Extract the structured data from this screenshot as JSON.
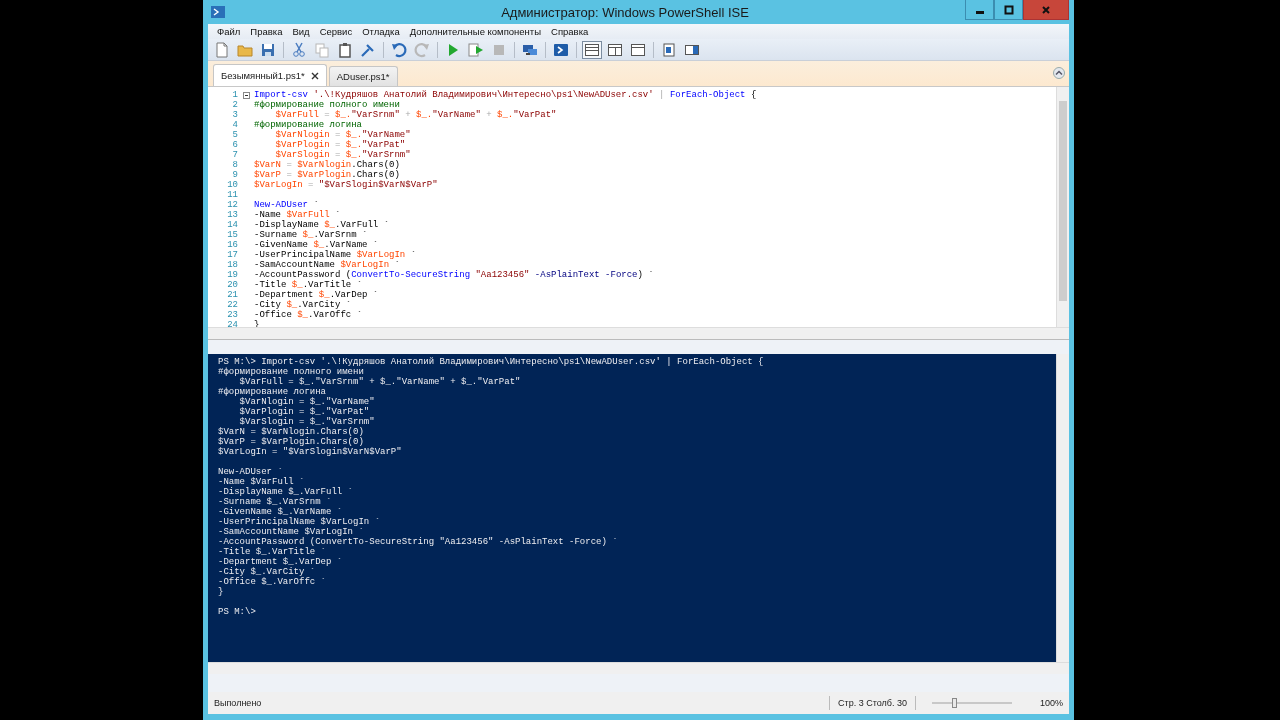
{
  "window": {
    "title": "Администратор: Windows PowerShell ISE"
  },
  "menu": [
    "Файл",
    "Правка",
    "Вид",
    "Сервис",
    "Отладка",
    "Дополнительные компоненты",
    "Справка"
  ],
  "toolbar": [
    {
      "kind": "new",
      "disabled": false
    },
    {
      "kind": "open",
      "disabled": false
    },
    {
      "kind": "save",
      "disabled": false
    },
    {
      "kind": "sep"
    },
    {
      "kind": "cut",
      "disabled": false
    },
    {
      "kind": "copy",
      "disabled": true
    },
    {
      "kind": "paste",
      "disabled": false
    },
    {
      "kind": "clear",
      "disabled": false
    },
    {
      "kind": "sep"
    },
    {
      "kind": "undo",
      "disabled": false
    },
    {
      "kind": "redo",
      "disabled": true
    },
    {
      "kind": "sep"
    },
    {
      "kind": "run",
      "disabled": false
    },
    {
      "kind": "runsel",
      "disabled": false
    },
    {
      "kind": "stop",
      "disabled": true
    },
    {
      "kind": "sep"
    },
    {
      "kind": "remote",
      "disabled": false
    },
    {
      "kind": "sep"
    },
    {
      "kind": "console",
      "disabled": false
    },
    {
      "kind": "sep"
    },
    {
      "kind": "layout-top",
      "selected": true
    },
    {
      "kind": "layout-right",
      "selected": false
    },
    {
      "kind": "layout-max",
      "selected": false
    },
    {
      "kind": "sep"
    },
    {
      "kind": "show-script",
      "disabled": false
    },
    {
      "kind": "show-addon",
      "disabled": false
    }
  ],
  "tabs": [
    {
      "label": "Безымянный1.ps1*",
      "selected": true
    },
    {
      "label": "ADuser.ps1*",
      "selected": false
    }
  ],
  "editor": {
    "lines": [
      {
        "number": "1",
        "fold": true,
        "tokens": [
          {
            "kind": "cmd",
            "text": "Import-csv"
          },
          {
            "kind": "str",
            "text": " '.\\!Кудряшов Анатолий Владимирович\\Интересно\\ps1\\NewADUser.csv'"
          },
          {
            "kind": "op",
            "text": " |"
          },
          {
            "kind": "cmd",
            "text": " ForEach-Object"
          },
          {
            "kind": "plain",
            "text": " {"
          }
        ]
      },
      {
        "number": "2",
        "tokens": [
          {
            "kind": "comment",
            "text": "#формирование полного имени"
          }
        ]
      },
      {
        "number": "3",
        "tokens": [
          {
            "kind": "var",
            "text": "    $VarFull"
          },
          {
            "kind": "op",
            "text": " = "
          },
          {
            "kind": "var",
            "text": "$_."
          },
          {
            "kind": "str",
            "text": "\"VarSrnm\""
          },
          {
            "kind": "op",
            "text": " + "
          },
          {
            "kind": "var",
            "text": "$_."
          },
          {
            "kind": "str",
            "text": "\"VarName\""
          },
          {
            "kind": "op",
            "text": " + "
          },
          {
            "kind": "var",
            "text": "$_."
          },
          {
            "kind": "str",
            "text": "\"VarPat\""
          }
        ]
      },
      {
        "number": "4",
        "tokens": [
          {
            "kind": "comment",
            "text": "#формирование логина"
          }
        ]
      },
      {
        "number": "5",
        "tokens": [
          {
            "kind": "var",
            "text": "    $VarNlogin"
          },
          {
            "kind": "op",
            "text": " = "
          },
          {
            "kind": "var",
            "text": "$_."
          },
          {
            "kind": "str",
            "text": "\"VarName\""
          }
        ]
      },
      {
        "number": "6",
        "tokens": [
          {
            "kind": "var",
            "text": "    $VarPlogin"
          },
          {
            "kind": "op",
            "text": " = "
          },
          {
            "kind": "var",
            "text": "$_."
          },
          {
            "kind": "str",
            "text": "\"VarPat\""
          }
        ]
      },
      {
        "number": "7",
        "tokens": [
          {
            "kind": "var",
            "text": "    $VarSlogin"
          },
          {
            "kind": "op",
            "text": " = "
          },
          {
            "kind": "var",
            "text": "$_."
          },
          {
            "kind": "str",
            "text": "\"VarSrnm\""
          }
        ]
      },
      {
        "number": "8",
        "tokens": [
          {
            "kind": "var",
            "text": "$VarN"
          },
          {
            "kind": "op",
            "text": " = "
          },
          {
            "kind": "var",
            "text": "$VarNlogin"
          },
          {
            "kind": "plain",
            "text": ".Chars(0)"
          }
        ]
      },
      {
        "number": "9",
        "tokens": [
          {
            "kind": "var",
            "text": "$VarP"
          },
          {
            "kind": "op",
            "text": " = "
          },
          {
            "kind": "var",
            "text": "$VarPlogin"
          },
          {
            "kind": "plain",
            "text": ".Chars(0)"
          }
        ]
      },
      {
        "number": "10",
        "tokens": [
          {
            "kind": "var",
            "text": "$VarLogIn"
          },
          {
            "kind": "op",
            "text": " = "
          },
          {
            "kind": "str",
            "text": "\"$VarSlogin$VarN$VarP\""
          }
        ]
      },
      {
        "number": "11"
      },
      {
        "number": "12",
        "tokens": [
          {
            "kind": "cmd",
            "text": "New-ADUser"
          },
          {
            "kind": "plain",
            "text": " `"
          }
        ]
      },
      {
        "number": "13",
        "tokens": [
          {
            "kind": "plain",
            "text": "-Name "
          },
          {
            "kind": "var",
            "text": "$VarFull"
          },
          {
            "kind": "plain",
            "text": " `"
          }
        ]
      },
      {
        "number": "14",
        "tokens": [
          {
            "kind": "plain",
            "text": "-DisplayName "
          },
          {
            "kind": "var",
            "text": "$_"
          },
          {
            "kind": "plain",
            "text": ".VarFull `"
          }
        ]
      },
      {
        "number": "15",
        "tokens": [
          {
            "kind": "plain",
            "text": "-Surname "
          },
          {
            "kind": "var",
            "text": "$_"
          },
          {
            "kind": "plain",
            "text": ".VarSrnm `"
          }
        ]
      },
      {
        "number": "16",
        "tokens": [
          {
            "kind": "plain",
            "text": "-GivenName "
          },
          {
            "kind": "var",
            "text": "$_"
          },
          {
            "kind": "plain",
            "text": ".VarName `"
          }
        ]
      },
      {
        "number": "17",
        "tokens": [
          {
            "kind": "plain",
            "text": "-UserPrincipalName "
          },
          {
            "kind": "var",
            "text": "$VarLogIn"
          },
          {
            "kind": "plain",
            "text": " `"
          }
        ]
      },
      {
        "number": "18",
        "tokens": [
          {
            "kind": "plain",
            "text": "-SamAccountName "
          },
          {
            "kind": "var",
            "text": "$VarLogIn"
          },
          {
            "kind": "plain",
            "text": " `"
          }
        ]
      },
      {
        "number": "19",
        "tokens": [
          {
            "kind": "plain",
            "text": "-AccountPassword ("
          },
          {
            "kind": "cmd",
            "text": "ConvertTo-SecureString"
          },
          {
            "kind": "str",
            "text": " \"Aa123456\""
          },
          {
            "kind": "param",
            "text": " -AsPlainText"
          },
          {
            "kind": "param",
            "text": " -Force"
          },
          {
            "kind": "plain",
            "text": ") `"
          }
        ]
      },
      {
        "number": "20",
        "tokens": [
          {
            "kind": "plain",
            "text": "-Title "
          },
          {
            "kind": "var",
            "text": "$_"
          },
          {
            "kind": "plain",
            "text": ".VarTitle `"
          }
        ]
      },
      {
        "number": "21",
        "tokens": [
          {
            "kind": "plain",
            "text": "-Department "
          },
          {
            "kind": "var",
            "text": "$_"
          },
          {
            "kind": "plain",
            "text": ".VarDep `"
          }
        ]
      },
      {
        "number": "22",
        "tokens": [
          {
            "kind": "plain",
            "text": "-City "
          },
          {
            "kind": "var",
            "text": "$_"
          },
          {
            "kind": "plain",
            "text": ".VarCity `"
          }
        ]
      },
      {
        "number": "23",
        "tokens": [
          {
            "kind": "plain",
            "text": "-Office "
          },
          {
            "kind": "var",
            "text": "$_"
          },
          {
            "kind": "plain",
            "text": ".VarOffc `"
          }
        ]
      },
      {
        "number": "24",
        "tokens": [
          {
            "kind": "plain",
            "text": "}"
          }
        ]
      }
    ]
  },
  "console": {
    "lines": [
      {
        "text": "PS M:\\> Import-csv '.\\!Кудряшов Анатолий Владимирович\\Интересно\\ps1\\NewADUser.csv' | ForEach-Object {"
      },
      {
        "text": "#формирование полного имени"
      },
      {
        "text": "    $VarFull = $_.\"VarSrnm\" + $_.\"VarName\" + $_.\"VarPat\""
      },
      {
        "text": "#формирование логина"
      },
      {
        "text": "    $VarNlogin = $_.\"VarName\""
      },
      {
        "text": "    $VarPlogin = $_.\"VarPat\""
      },
      {
        "text": "    $VarSlogin = $_.\"VarSrnm\""
      },
      {
        "text": "$VarN = $VarNlogin.Chars(0)"
      },
      {
        "text": "$VarP = $VarPlogin.Chars(0)"
      },
      {
        "text": "$VarLogIn = \"$VarSlogin$VarN$VarP\""
      },
      {
        "text": "New-ADUser `",
        "space_before": true
      },
      {
        "text": "-Name $VarFull `"
      },
      {
        "text": "-DisplayName $_.VarFull `"
      },
      {
        "text": "-Surname $_.VarSrnm `"
      },
      {
        "text": "-GivenName $_.VarName `"
      },
      {
        "text": "-UserPrincipalName $VarLogIn `"
      },
      {
        "text": "-SamAccountName $VarLogIn `"
      },
      {
        "text": "-AccountPassword (ConvertTo-SecureString \"Aa123456\" -AsPlainText -Force) `"
      },
      {
        "text": "-Title $_.VarTitle `"
      },
      {
        "text": "-Department $_.VarDep `"
      },
      {
        "text": "-City $_.VarCity `"
      },
      {
        "text": "-Office $_.VarOffc `"
      },
      {
        "text": "}"
      },
      {
        "text": "PS M:\\>",
        "space_before": true
      }
    ]
  },
  "status": {
    "message": "Выполнено",
    "line": "Стр. 3",
    "column": "Столб. 30",
    "zoom_slider": {
      "level": 0.27
    },
    "zoom": "100%"
  }
}
